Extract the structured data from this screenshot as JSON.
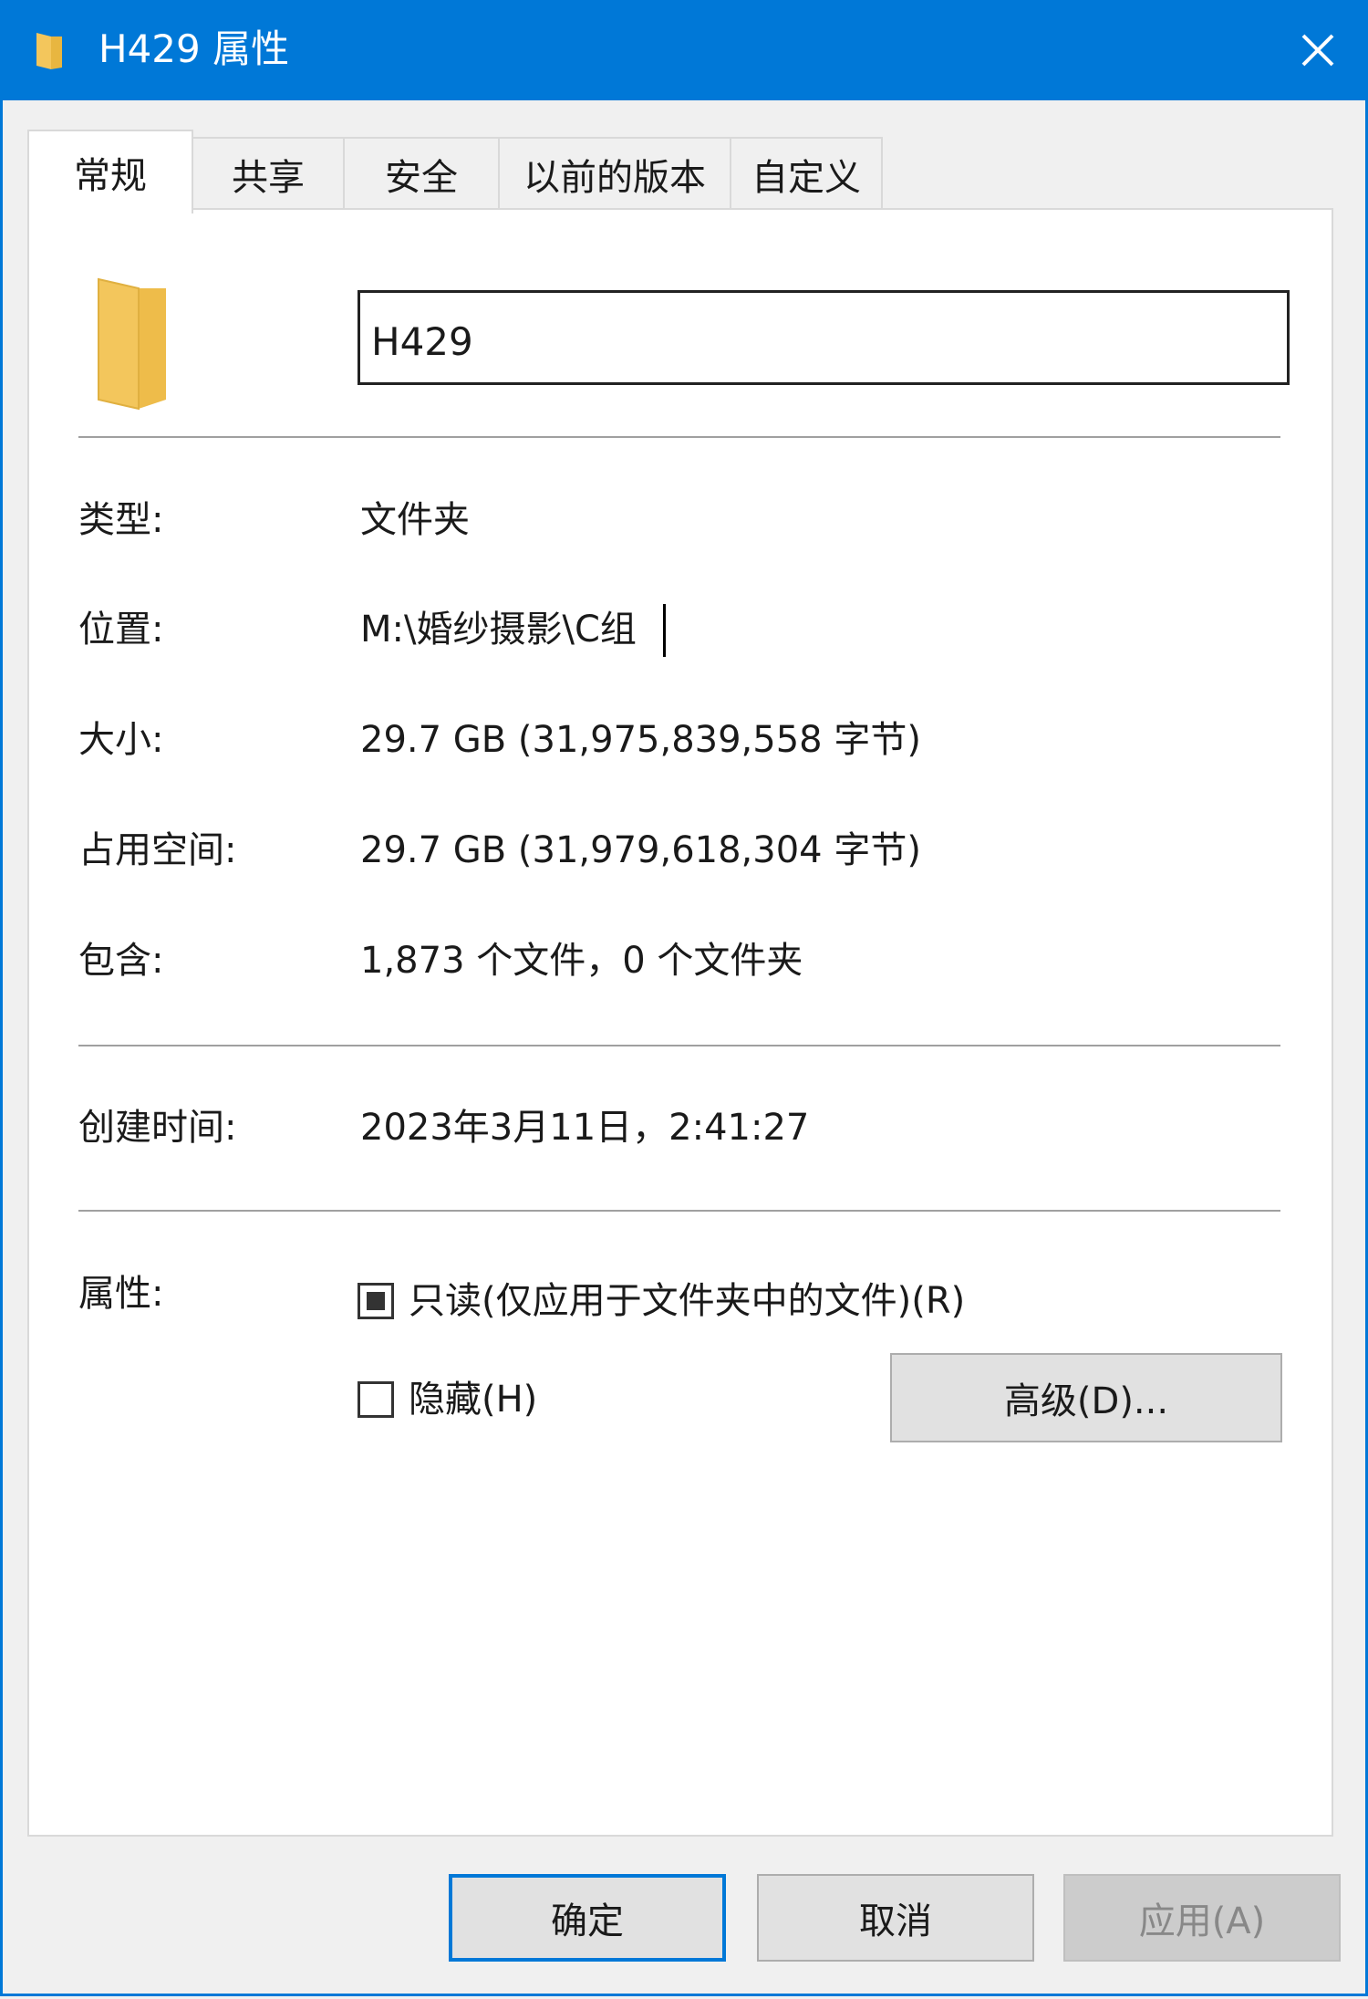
{
  "window": {
    "title": "H429 属性",
    "close_symbol": "✕"
  },
  "tabs": [
    {
      "label": "常规",
      "active": true
    },
    {
      "label": "共享",
      "active": false
    },
    {
      "label": "安全",
      "active": false
    },
    {
      "label": "以前的版本",
      "active": false
    },
    {
      "label": "自定义",
      "active": false
    }
  ],
  "general": {
    "folder_name": "H429",
    "type_label": "类型:",
    "type_value": "文件夹",
    "location_label": "位置:",
    "location_value": "M:\\婚纱摄影\\C组",
    "size_label": "大小:",
    "size_value": "29.7 GB (31,975,839,558 字节)",
    "disk_size_label": "占用空间:",
    "disk_size_value": "29.7 GB (31,979,618,304 字节)",
    "contains_label": "包含:",
    "contains_value": "1,873 个文件，0 个文件夹",
    "created_label": "创建时间:",
    "created_value": "2023年3月11日，2:41:27",
    "attributes_label": "属性:",
    "readonly_label": "只读(仅应用于文件夹中的文件)(R)",
    "readonly_state": "indeterminate",
    "hidden_label": "隐藏(H)",
    "hidden_checked": false,
    "advanced_button": "高级(D)..."
  },
  "footer": {
    "ok": "确定",
    "cancel": "取消",
    "apply": "应用(A)",
    "apply_enabled": false
  },
  "colors": {
    "accent": "#0078d7",
    "folder": "#f3c65c"
  }
}
